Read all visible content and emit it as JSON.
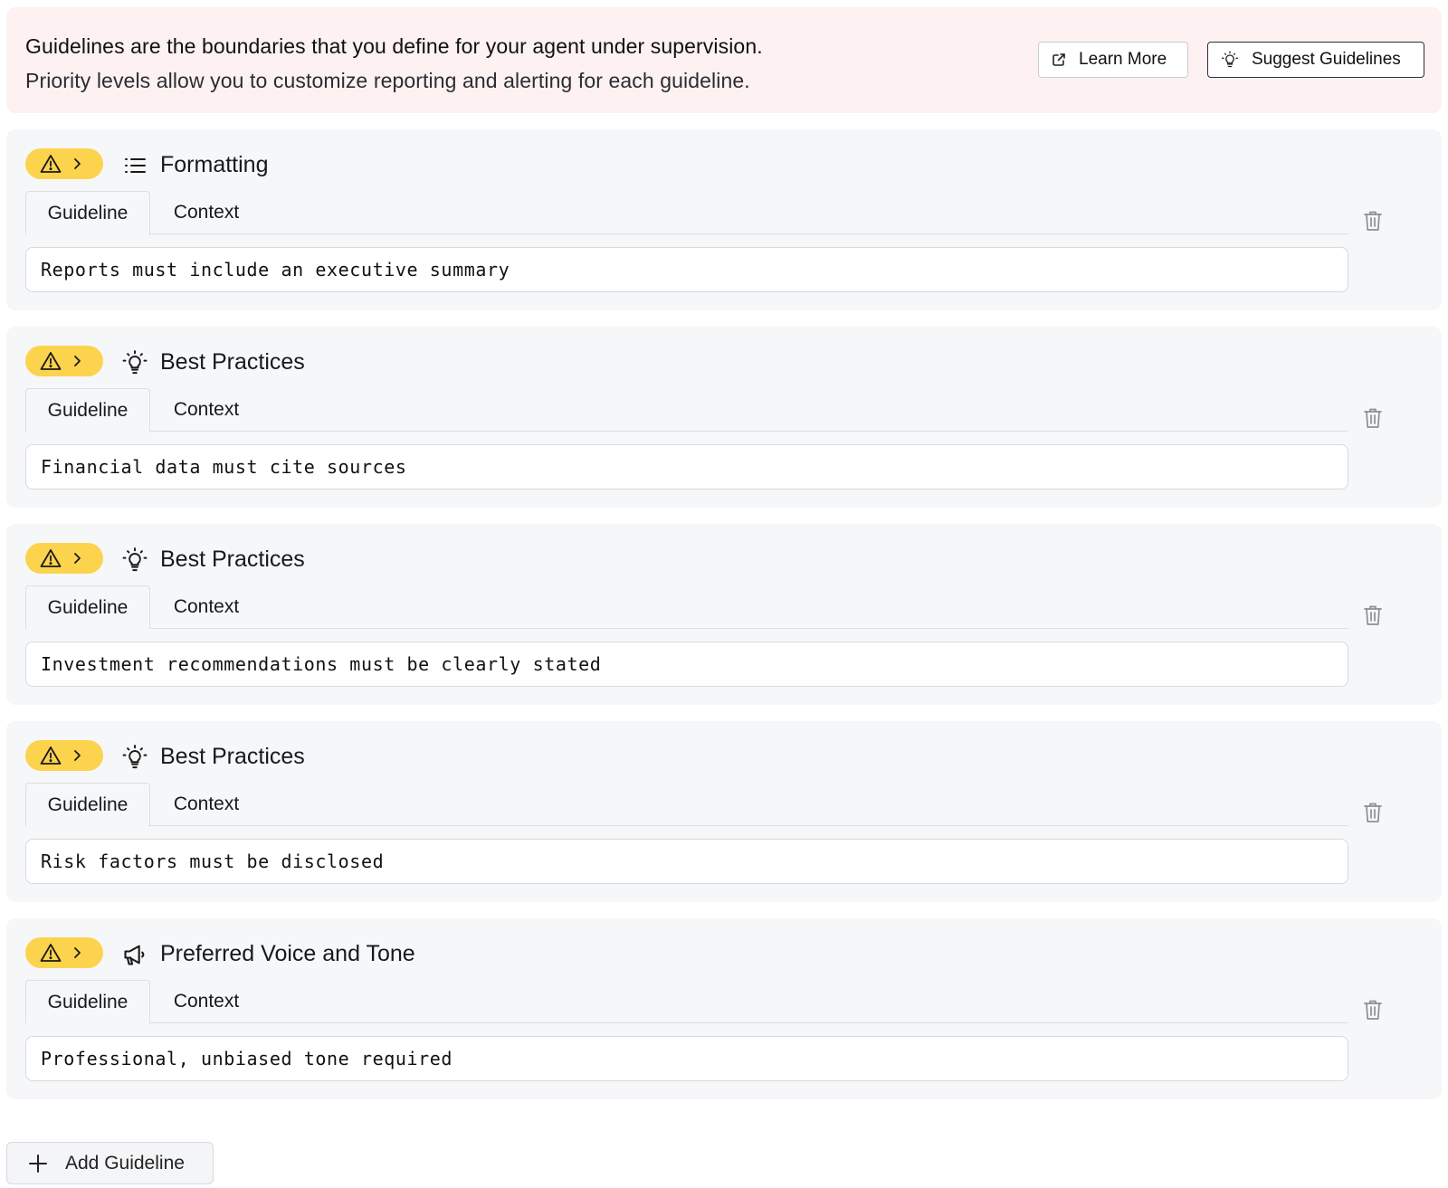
{
  "banner": {
    "title": "Guidelines are the boundaries that you define for your agent under supervision.",
    "subtitle": "Priority levels allow you to customize reporting and alerting for each guideline.",
    "learn_more_label": "Learn More",
    "suggest_label": "Suggest Guidelines",
    "background": "#fdf1f1"
  },
  "colors": {
    "priority_pill": "#fcd34d",
    "card_background": "#f6f7f9"
  },
  "guidelines": [
    {
      "priority_icon": "warning-triangle-icon",
      "category_icon": "list-icon",
      "category": "Formatting",
      "tabs": [
        "Guideline",
        "Context"
      ],
      "text": "Reports must include an executive summary"
    },
    {
      "priority_icon": "warning-triangle-icon",
      "category_icon": "lightbulb-icon",
      "category": "Best Practices",
      "tabs": [
        "Guideline",
        "Context"
      ],
      "text": "Financial data must cite sources"
    },
    {
      "priority_icon": "warning-triangle-icon",
      "category_icon": "lightbulb-icon",
      "category": "Best Practices",
      "tabs": [
        "Guideline",
        "Context"
      ],
      "text": "Investment recommendations must be clearly stated"
    },
    {
      "priority_icon": "warning-triangle-icon",
      "category_icon": "lightbulb-icon",
      "category": "Best Practices",
      "tabs": [
        "Guideline",
        "Context"
      ],
      "text": "Risk factors must be disclosed"
    },
    {
      "priority_icon": "warning-triangle-icon",
      "category_icon": "megaphone-icon",
      "category": "Preferred Voice and Tone",
      "tabs": [
        "Guideline",
        "Context"
      ],
      "text": "Professional, unbiased tone required"
    }
  ],
  "add_button_label": "Add Guideline"
}
